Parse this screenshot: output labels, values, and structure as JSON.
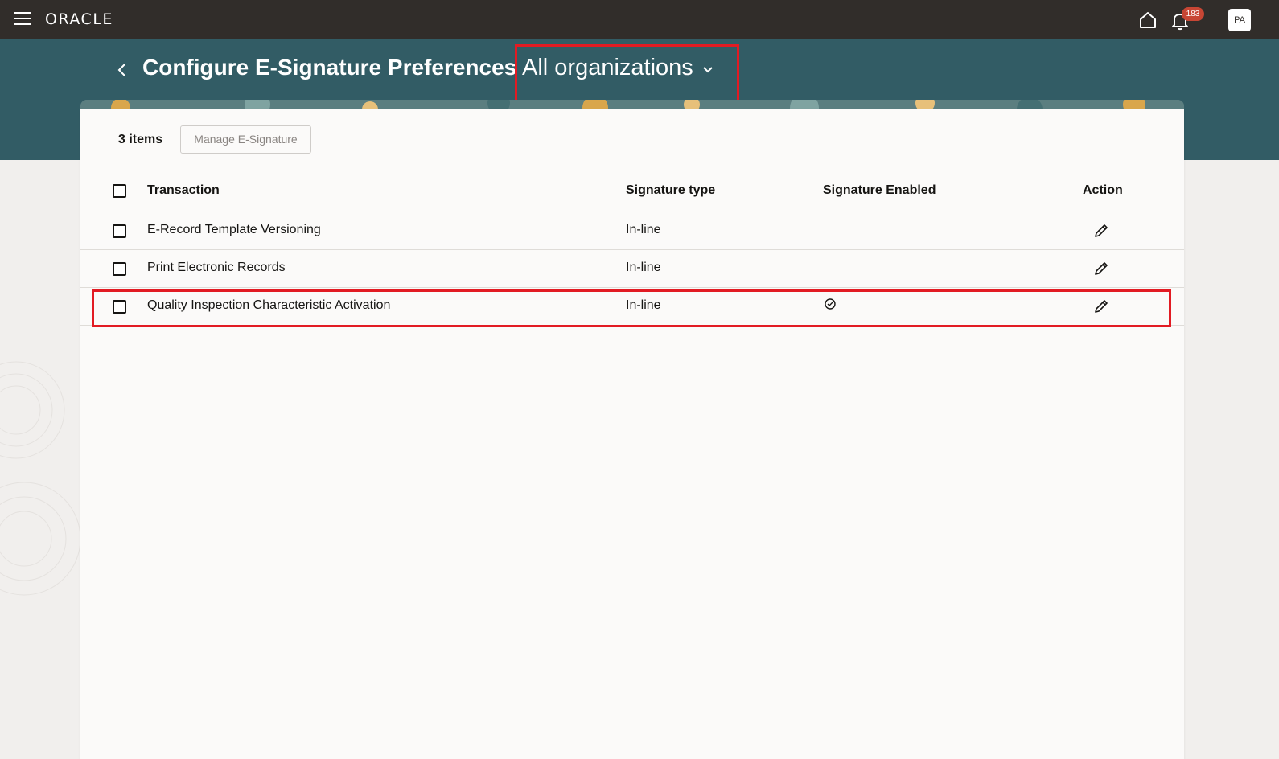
{
  "topbar": {
    "logo": "ORACLE",
    "notification_count": "183",
    "avatar_initials": "PA"
  },
  "header": {
    "title": "Configure E-Signature Preferences",
    "org_selector": "All organizations"
  },
  "toolbar": {
    "item_count": "3 items",
    "manage_button": "Manage E-Signature"
  },
  "table": {
    "columns": [
      "Transaction",
      "Signature type",
      "Signature Enabled",
      "Action"
    ],
    "rows": [
      {
        "transaction": "E-Record Template Versioning",
        "signature_type": "In-line",
        "signature_enabled": false
      },
      {
        "transaction": "Print Electronic Records",
        "signature_type": "In-line",
        "signature_enabled": false
      },
      {
        "transaction": "Quality Inspection Characteristic Activation",
        "signature_type": "In-line",
        "signature_enabled": true
      }
    ]
  },
  "icons": [
    "hamburger-menu-icon",
    "home-icon",
    "bell-icon",
    "back-icon",
    "chevron-down-icon",
    "edit-icon",
    "check-circle-icon"
  ],
  "colors": {
    "topbar": "#312d2a",
    "header_band": "#325c65",
    "highlight": "#e21b23",
    "badge": "#c74634"
  }
}
